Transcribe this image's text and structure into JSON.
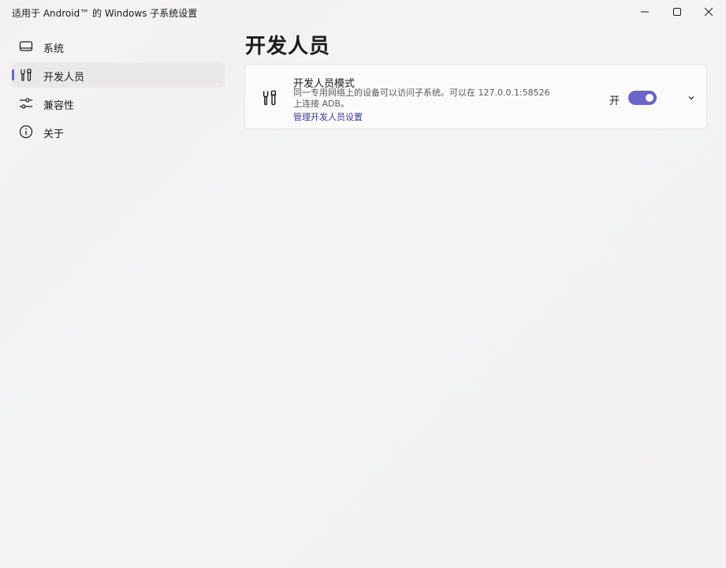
{
  "window": {
    "title": "适用于 Android™ 的 Windows 子系统设置",
    "controls": {
      "minimize_icon": "minimize-icon",
      "maximize_icon": "maximize-icon",
      "close_icon": "close-icon"
    }
  },
  "sidebar": {
    "items": [
      {
        "label": "系统",
        "icon": "display-icon",
        "selected": false
      },
      {
        "label": "开发人员",
        "icon": "developer-tools-icon",
        "selected": true
      },
      {
        "label": "兼容性",
        "icon": "sliders-icon",
        "selected": false
      },
      {
        "label": "关于",
        "icon": "info-icon",
        "selected": false
      }
    ]
  },
  "main": {
    "page_title": "开发人员",
    "developer_mode": {
      "icon": "developer-tools-icon",
      "title": "开发人员模式",
      "description": "同一专用网络上的设备可以访问子系统。可以在 127.0.0.1:58526 上连接 ADB。",
      "link": "管理开发人员设置",
      "toggle_state_label": "开",
      "toggle_on": true,
      "expand_icon": "chevron-down-icon"
    }
  },
  "colors": {
    "accent": "#6b63c8",
    "link": "#3a3a9a",
    "card_background": "#fbfbfb"
  }
}
